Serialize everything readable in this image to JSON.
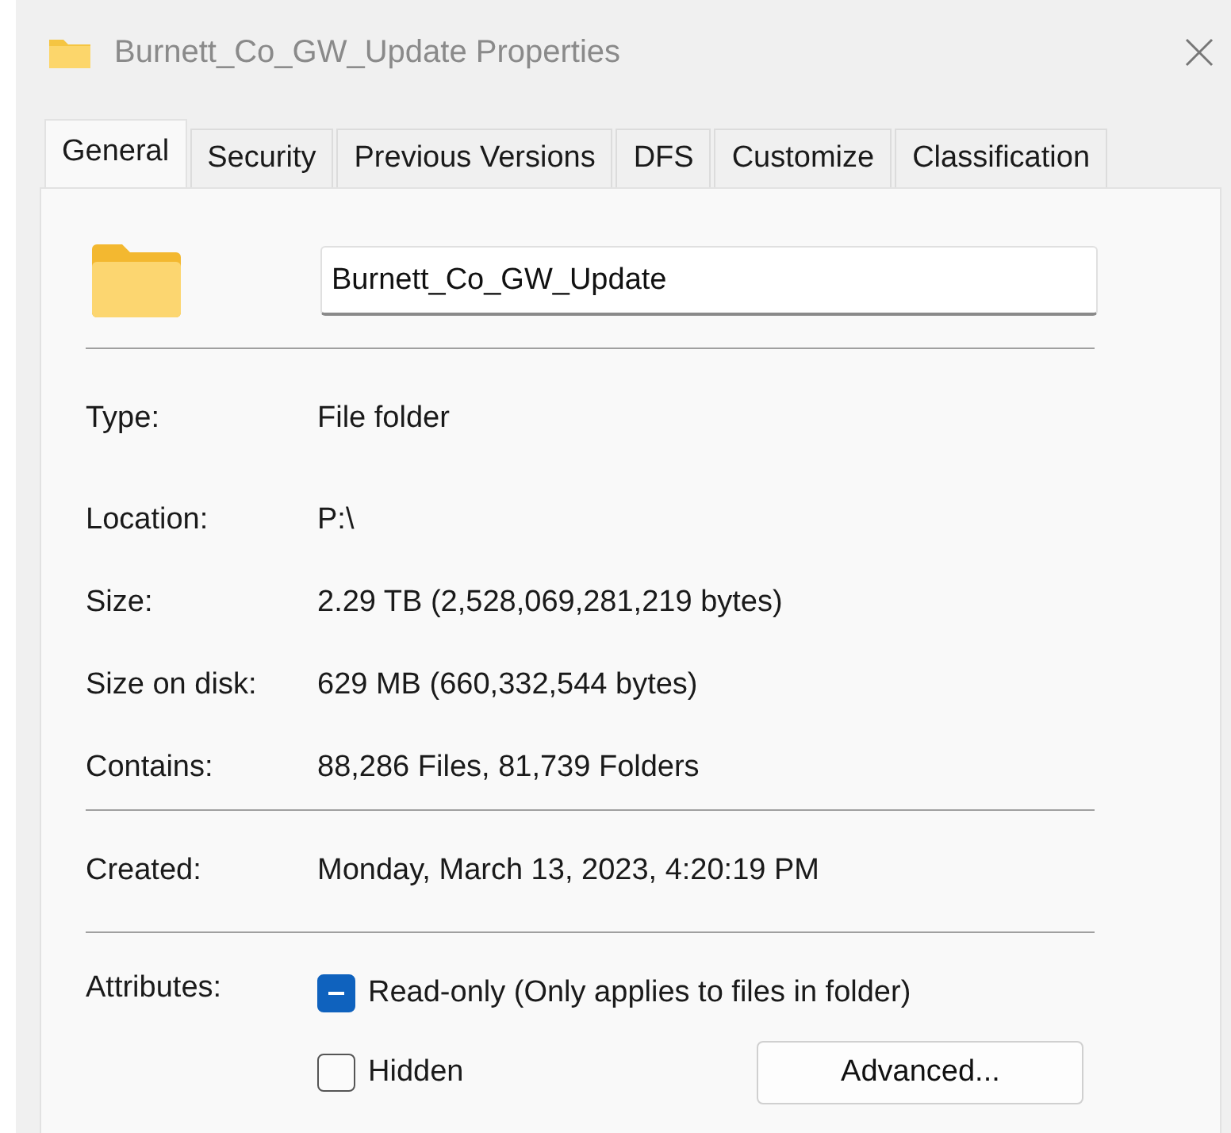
{
  "window": {
    "title": "Burnett_Co_GW_Update Properties"
  },
  "tabs": [
    {
      "label": "General",
      "selected": true
    },
    {
      "label": "Security",
      "selected": false
    },
    {
      "label": "Previous Versions",
      "selected": false
    },
    {
      "label": "DFS",
      "selected": false
    },
    {
      "label": "Customize",
      "selected": false
    },
    {
      "label": "Classification",
      "selected": false
    }
  ],
  "name_field": {
    "value": "Burnett_Co_GW_Update"
  },
  "properties": [
    {
      "label": "Type:",
      "value": "File folder"
    },
    {
      "label": "Location:",
      "value": "P:\\"
    },
    {
      "label": "Size:",
      "value": "2.29 TB (2,528,069,281,219 bytes)"
    },
    {
      "label": "Size on disk:",
      "value": "629 MB (660,332,544 bytes)"
    },
    {
      "label": "Contains:",
      "value": "88,286 Files, 81,739 Folders"
    }
  ],
  "created": {
    "label": "Created:",
    "value": "Monday, March 13, 2023, 4:20:19 PM"
  },
  "attributes": {
    "label": "Attributes:",
    "items": [
      {
        "label": "Read-only (Only applies to files in folder)",
        "checked": false,
        "indeterminate": true
      },
      {
        "label": "Hidden",
        "checked": false,
        "indeterminate": false
      }
    ],
    "button": "Advanced..."
  }
}
